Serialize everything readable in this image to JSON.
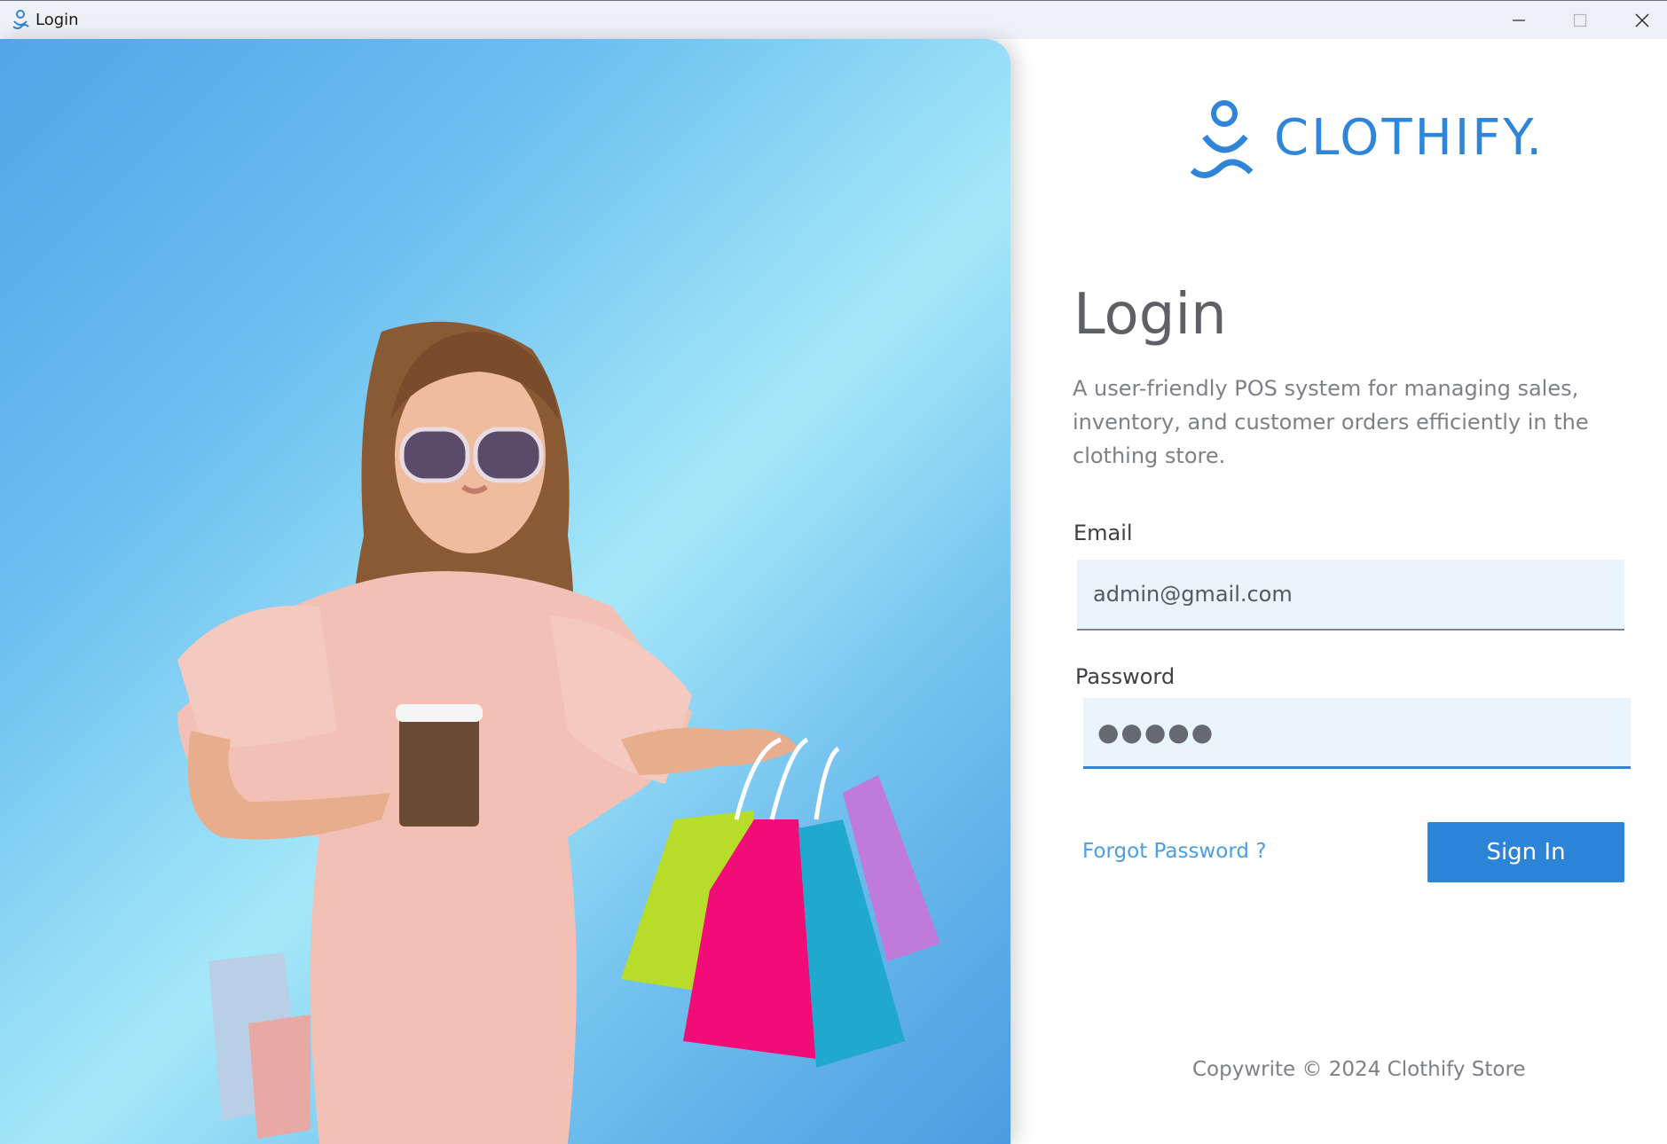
{
  "window": {
    "title": "Login",
    "icon": "clothify-logo-icon",
    "controls": [
      "minimize-icon",
      "maximize-icon",
      "close-icon"
    ]
  },
  "brand": {
    "name": "CLOTHIFY.",
    "color": "#2f86d8"
  },
  "login": {
    "title": "Login",
    "description": "A user-friendly POS system for managing sales, inventory, and customer orders efficiently in the clothing store.",
    "email_label": "Email",
    "email_value": "admin@gmail.com",
    "password_label": "Password",
    "password_value": "●●●●●",
    "forgot_label": "Forgot Password ?",
    "signin_label": "Sign In"
  },
  "footer": {
    "copyright": "Copywrite © 2024 Clothify Store"
  },
  "colors": {
    "accent": "#2c84d9",
    "field_bg": "#e9f4fd",
    "hero_gradient": [
      "#50a6e8",
      "#a6e8f9",
      "#4b9ce2"
    ]
  }
}
